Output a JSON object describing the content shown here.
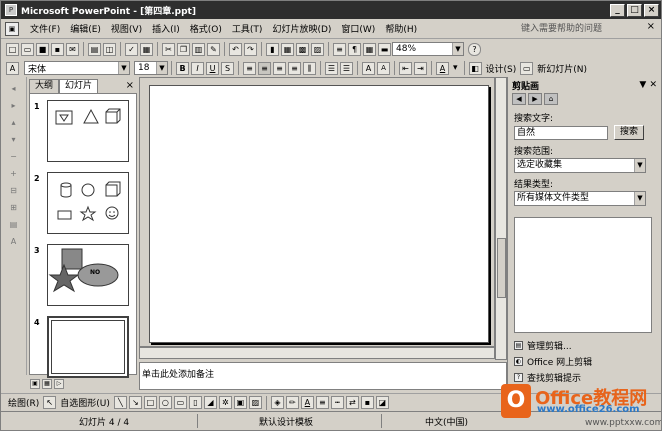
{
  "window": {
    "title": "Microsoft PowerPoint - [第四章.ppt]",
    "controls": [
      "_",
      "□",
      "×"
    ]
  },
  "menubar": {
    "items": [
      "文件(F)",
      "编辑(E)",
      "视图(V)",
      "插入(I)",
      "格式(O)",
      "工具(T)",
      "幻灯片放映(D)",
      "窗口(W)",
      "帮助(H)"
    ],
    "help_placeholder": "键入需要帮助的问题",
    "close": "×"
  },
  "standard_toolbar": {
    "zoom": "48%",
    "help_icon": "?"
  },
  "format_toolbar": {
    "font": "宋体",
    "size": "18",
    "bold": "B",
    "italic": "I",
    "underline": "U",
    "shadow": "S",
    "increase_font": "A",
    "decrease_font": "A",
    "font_color": "A",
    "design_label": "设计(S)",
    "new_slide_label": "新幻灯片(N)"
  },
  "left_pane": {
    "tab_outline": "大纲",
    "tab_slides": "幻灯片",
    "close": "×",
    "slides": [
      {
        "number": "1"
      },
      {
        "number": "2"
      },
      {
        "number": "3",
        "label": "NO"
      },
      {
        "number": "4"
      }
    ]
  },
  "editor": {
    "notes_placeholder": "单击此处添加备注"
  },
  "task_pane": {
    "title": "剪贴画",
    "search_text_label": "搜索文字:",
    "search_value": "自然",
    "search_button": "搜索",
    "scope_label": "搜索范围:",
    "scope_value": "选定收藏集",
    "result_type_label": "结果类型:",
    "result_type_value": "所有媒体文件类型",
    "links": [
      "管理剪辑...",
      "Office 网上剪辑",
      "查找剪辑提示"
    ]
  },
  "drawing_toolbar": {
    "draw_label": "绘图(R)",
    "autoshapes_label": "自选图形(U)"
  },
  "statusbar": {
    "slide_info": "幻灯片 4 / 4",
    "design": "默认设计模板",
    "language": "中文(中国)"
  },
  "watermark": {
    "logo_letter": "O",
    "title": "Office教程网",
    "url1": "www.office26.com",
    "url2": "www.pptxxw.com"
  }
}
